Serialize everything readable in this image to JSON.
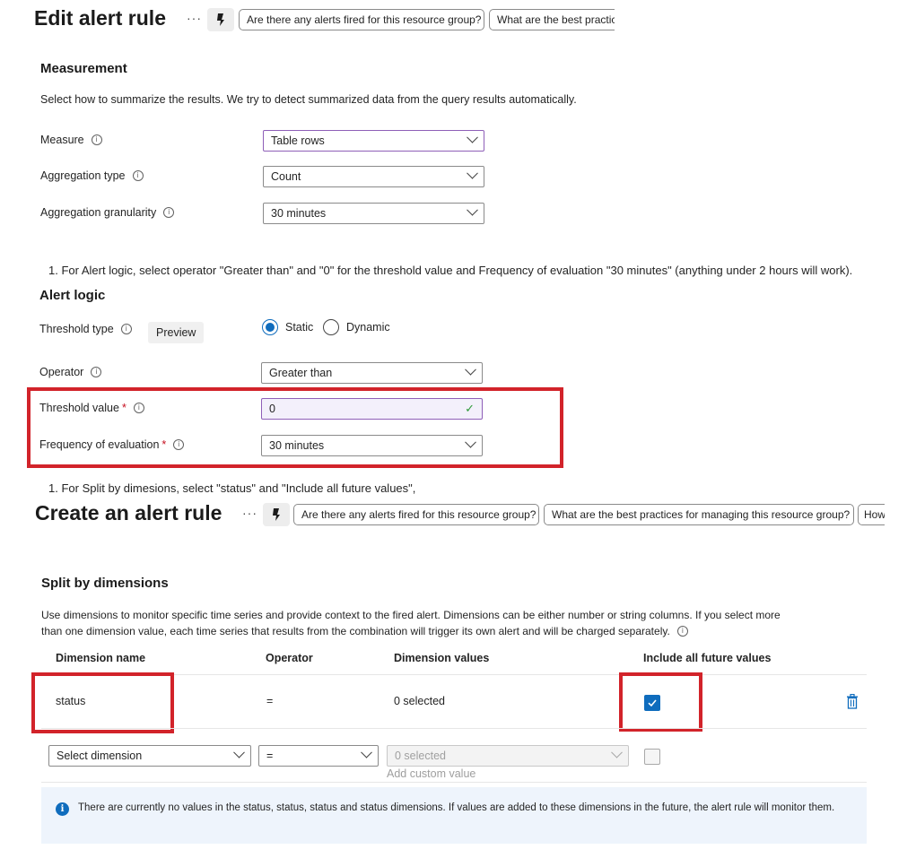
{
  "edit_header": {
    "title": "Edit alert rule",
    "more": "···",
    "copilot_icon": "copilot-icon",
    "suggestions": [
      "Are there any alerts fired for this resource group?",
      "What are the best practic"
    ]
  },
  "measurement": {
    "heading": "Measurement",
    "description": "Select how to summarize the results. We try to detect summarized data from the query results automatically.",
    "fields": [
      {
        "label": "Measure",
        "value": "Table rows"
      },
      {
        "label": "Aggregation type",
        "value": "Count"
      },
      {
        "label": "Aggregation granularity",
        "value": "30 minutes"
      }
    ]
  },
  "step_alert_logic": "1. For Alert logic, select operator \"Greater than\" and \"0\" for the threshold value and Frequency of evaluation \"30 minutes\" (anything under 2 hours will work).",
  "alert_logic": {
    "heading": "Alert logic",
    "threshold_type_label": "Threshold type",
    "preview_badge": "Preview",
    "radio_static": "Static",
    "radio_dynamic": "Dynamic",
    "operator_label": "Operator",
    "operator_value": "Greater than",
    "threshold_value_label": "Threshold value",
    "threshold_value": "0",
    "frequency_label": "Frequency of evaluation",
    "frequency_value": "30 minutes",
    "required_mark": "*"
  },
  "step_split": "1. For Split by dimesions, select \"status\" and \"Include all future values\",",
  "create_header": {
    "title": "Create an alert rule",
    "more": "···",
    "suggestions": [
      "Are there any alerts fired for this resource group?",
      "What are the best practices for managing this resource group?",
      "How"
    ]
  },
  "split": {
    "heading": "Split by dimensions",
    "description_line1": "Use dimensions to monitor specific time series and provide context to the fired alert. Dimensions can be either number or string columns. If you select more",
    "description_line2": "than one dimension value, each time series that results from the combination will trigger its own alert and will be charged separately.",
    "columns": [
      "Dimension name",
      "Operator",
      "Dimension values",
      "Include all future values"
    ],
    "rows": [
      {
        "name": "status",
        "operator": "=",
        "values": "0 selected",
        "include_future": true
      }
    ],
    "new_row": {
      "dimension_placeholder": "Select dimension",
      "operator": "=",
      "values_placeholder": "0 selected",
      "add_custom": "Add custom value"
    },
    "banner": "There are currently no values in the status, status, status and status dimensions. If values are added to these dimensions in the future, the alert rule will monitor them."
  },
  "colors": {
    "highlight": "#d2232a",
    "accent": "#0f6cbd",
    "focus_border": "#8e5fb8"
  }
}
